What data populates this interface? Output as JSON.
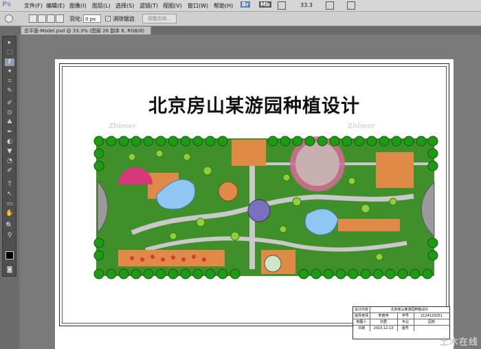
{
  "app": {
    "logo": "Ps"
  },
  "menu": [
    "文件(F)",
    "编辑(E)",
    "图像(I)",
    "图层(L)",
    "选择(S)",
    "滤镜(T)",
    "视图(V)",
    "窗口(W)",
    "帮助(H)"
  ],
  "appbar": {
    "br_label": "Br",
    "mb_label": "Mb",
    "zoom": "33.3"
  },
  "options": {
    "feather_label": "羽化:",
    "feather_value": "0 px",
    "antialias_label": "消除锯齿",
    "refine_label": "调整边缘..."
  },
  "document": {
    "tab_title": "总平面-Model.psd @ 33.3% (图层 26 副本 6, RGB/8)"
  },
  "tools": [
    "▸",
    "⬚",
    "ℓ",
    "✦",
    "⌗",
    "✎",
    "✐",
    "⊙",
    "♣",
    "✒",
    "◐",
    "▼",
    "◔",
    "✐",
    "T",
    "↖",
    "▭",
    "✋",
    "🔍"
  ],
  "drawing": {
    "title": "北京房山某游园种植设计",
    "watermark": "Zhimer",
    "title_block": {
      "header": "北京房山某游园种植设计",
      "row1": [
        "设计内容",
        ""
      ],
      "row2": [
        "指导老师",
        "朱丽萍",
        "学号",
        "2124123251"
      ],
      "row3": [
        "制图人",
        "刘君",
        "专业",
        "园林"
      ],
      "row4": [
        "日期",
        "2015.12.13",
        "图号",
        ""
      ]
    }
  },
  "site_watermark": "土木在线",
  "colors": {
    "lawn": "#3f8f2a",
    "tree": "#1f9a16",
    "path": "#c9c9c9",
    "paving": "#e08a48",
    "water": "#8ec8f2",
    "pink": "#d76b9a"
  }
}
